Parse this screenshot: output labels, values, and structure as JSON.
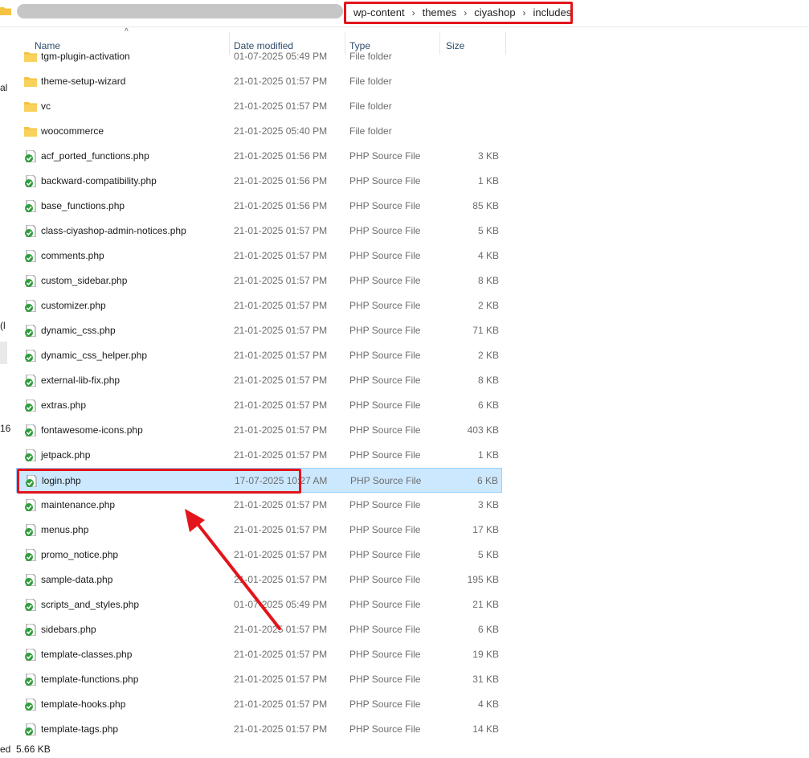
{
  "breadcrumb": [
    "wp-content",
    "themes",
    "ciyashop",
    "includes"
  ],
  "left_clipped": [
    "al",
    "(l",
    "16"
  ],
  "columns": {
    "name": "Name",
    "date": "Date modified",
    "type": "Type",
    "size": "Size"
  },
  "files": [
    {
      "name": "tgm-plugin-activation",
      "date": "01-07-2025 05:49 PM",
      "type": "File folder",
      "size": "",
      "kind": "folder"
    },
    {
      "name": "theme-setup-wizard",
      "date": "21-01-2025 01:57 PM",
      "type": "File folder",
      "size": "",
      "kind": "folder"
    },
    {
      "name": "vc",
      "date": "21-01-2025 01:57 PM",
      "type": "File folder",
      "size": "",
      "kind": "folder"
    },
    {
      "name": "woocommerce",
      "date": "21-01-2025 05:40 PM",
      "type": "File folder",
      "size": "",
      "kind": "folder"
    },
    {
      "name": "acf_ported_functions.php",
      "date": "21-01-2025 01:56 PM",
      "type": "PHP Source File",
      "size": "3 KB",
      "kind": "php"
    },
    {
      "name": "backward-compatibility.php",
      "date": "21-01-2025 01:56 PM",
      "type": "PHP Source File",
      "size": "1 KB",
      "kind": "php"
    },
    {
      "name": "base_functions.php",
      "date": "21-01-2025 01:56 PM",
      "type": "PHP Source File",
      "size": "85 KB",
      "kind": "php"
    },
    {
      "name": "class-ciyashop-admin-notices.php",
      "date": "21-01-2025 01:57 PM",
      "type": "PHP Source File",
      "size": "5 KB",
      "kind": "php"
    },
    {
      "name": "comments.php",
      "date": "21-01-2025 01:57 PM",
      "type": "PHP Source File",
      "size": "4 KB",
      "kind": "php"
    },
    {
      "name": "custom_sidebar.php",
      "date": "21-01-2025 01:57 PM",
      "type": "PHP Source File",
      "size": "8 KB",
      "kind": "php"
    },
    {
      "name": "customizer.php",
      "date": "21-01-2025 01:57 PM",
      "type": "PHP Source File",
      "size": "2 KB",
      "kind": "php"
    },
    {
      "name": "dynamic_css.php",
      "date": "21-01-2025 01:57 PM",
      "type": "PHP Source File",
      "size": "71 KB",
      "kind": "php"
    },
    {
      "name": "dynamic_css_helper.php",
      "date": "21-01-2025 01:57 PM",
      "type": "PHP Source File",
      "size": "2 KB",
      "kind": "php"
    },
    {
      "name": "external-lib-fix.php",
      "date": "21-01-2025 01:57 PM",
      "type": "PHP Source File",
      "size": "8 KB",
      "kind": "php"
    },
    {
      "name": "extras.php",
      "date": "21-01-2025 01:57 PM",
      "type": "PHP Source File",
      "size": "6 KB",
      "kind": "php"
    },
    {
      "name": "fontawesome-icons.php",
      "date": "21-01-2025 01:57 PM",
      "type": "PHP Source File",
      "size": "403 KB",
      "kind": "php"
    },
    {
      "name": "jetpack.php",
      "date": "21-01-2025 01:57 PM",
      "type": "PHP Source File",
      "size": "1 KB",
      "kind": "php"
    },
    {
      "name": "login.php",
      "date": "17-07-2025 10:27 AM",
      "type": "PHP Source File",
      "size": "6 KB",
      "kind": "php",
      "selected": true
    },
    {
      "name": "maintenance.php",
      "date": "21-01-2025 01:57 PM",
      "type": "PHP Source File",
      "size": "3 KB",
      "kind": "php"
    },
    {
      "name": "menus.php",
      "date": "21-01-2025 01:57 PM",
      "type": "PHP Source File",
      "size": "17 KB",
      "kind": "php"
    },
    {
      "name": "promo_notice.php",
      "date": "21-01-2025 01:57 PM",
      "type": "PHP Source File",
      "size": "5 KB",
      "kind": "php"
    },
    {
      "name": "sample-data.php",
      "date": "21-01-2025 01:57 PM",
      "type": "PHP Source File",
      "size": "195 KB",
      "kind": "php"
    },
    {
      "name": "scripts_and_styles.php",
      "date": "01-07-2025 05:49 PM",
      "type": "PHP Source File",
      "size": "21 KB",
      "kind": "php"
    },
    {
      "name": "sidebars.php",
      "date": "21-01-2025 01:57 PM",
      "type": "PHP Source File",
      "size": "6 KB",
      "kind": "php"
    },
    {
      "name": "template-classes.php",
      "date": "21-01-2025 01:57 PM",
      "type": "PHP Source File",
      "size": "19 KB",
      "kind": "php"
    },
    {
      "name": "template-functions.php",
      "date": "21-01-2025 01:57 PM",
      "type": "PHP Source File",
      "size": "31 KB",
      "kind": "php"
    },
    {
      "name": "template-hooks.php",
      "date": "21-01-2025 01:57 PM",
      "type": "PHP Source File",
      "size": "4 KB",
      "kind": "php"
    },
    {
      "name": "template-tags.php",
      "date": "21-01-2025 01:57 PM",
      "type": "PHP Source File",
      "size": "14 KB",
      "kind": "php"
    }
  ],
  "status": {
    "left": "ed",
    "size": "5.66 KB"
  },
  "colors": {
    "highlight": "#e3141b",
    "selected_bg": "#cce8ff",
    "folder": "#f5c342",
    "php_check": "#2e9e3a"
  }
}
